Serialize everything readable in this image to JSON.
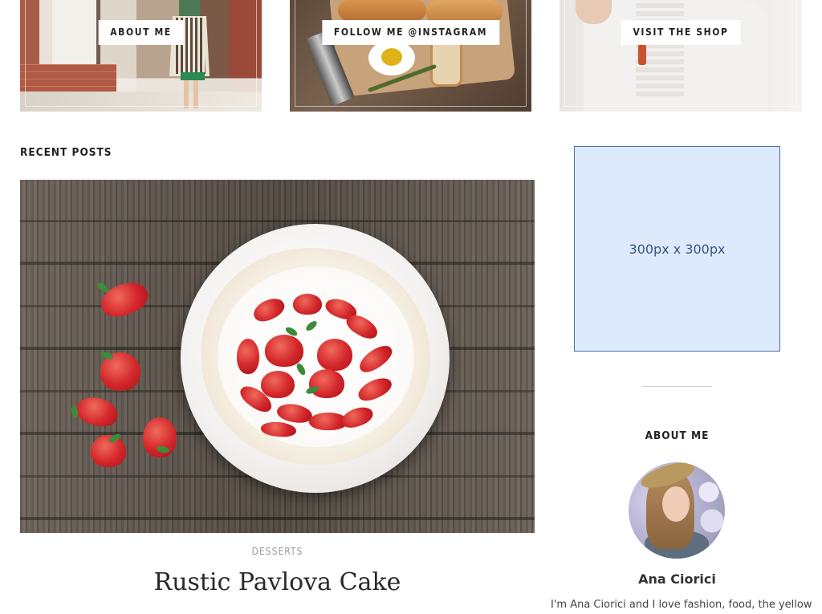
{
  "promos": {
    "about_label": "ABOUT ME",
    "instagram_label": "FOLLOW ME @INSTAGRAM",
    "shop_label": "VISIT THE SHOP"
  },
  "recent_posts": {
    "heading": "RECENT POSTS",
    "post": {
      "category": "DESSERTS",
      "title": "Rustic Pavlova Cake"
    }
  },
  "sidebar": {
    "ad_placeholder": "300px x 300px",
    "about": {
      "heading": "ABOUT ME",
      "name": "Ana Ciorici",
      "bio": "I'm Ana Ciorici and I love fashion, food, the yellow"
    }
  },
  "colors": {
    "ad_background": "#ddeafc",
    "ad_border": "#4a6ea8",
    "heading_text": "#222222",
    "category_text": "#9a9a9a"
  }
}
